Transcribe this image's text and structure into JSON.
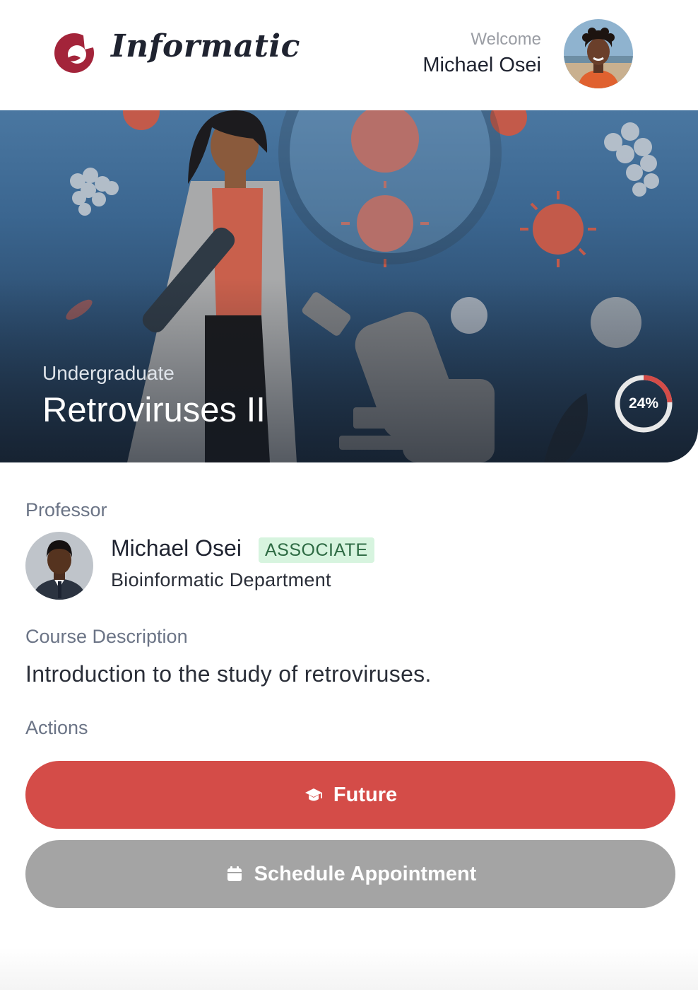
{
  "header": {
    "brand": "Informatic",
    "welcome": "Welcome",
    "user_name": "Michael Osei"
  },
  "hero": {
    "level": "Undergraduate",
    "title": "Retroviruses II",
    "progress_percent": 24,
    "progress_label": "24%"
  },
  "professor": {
    "section_label": "Professor",
    "name": "Michael Osei",
    "rank": "ASSOCIATE",
    "department": "Bioinformatic Department"
  },
  "description": {
    "section_label": "Course Description",
    "text": "Introduction to the study of retroviruses."
  },
  "actions": {
    "section_label": "Actions",
    "primary_label": "Future",
    "primary_icon": "graduation-cap-icon",
    "secondary_label": "Schedule Appointment",
    "secondary_icon": "calendar-icon"
  },
  "colors": {
    "accent": "#d44c48",
    "badge_bg": "#d7f4df",
    "badge_text": "#2d6a43",
    "secondary_button": "#a4a4a4",
    "hero_top": "#4a77a1",
    "hero_bottom": "#1c2d40"
  }
}
